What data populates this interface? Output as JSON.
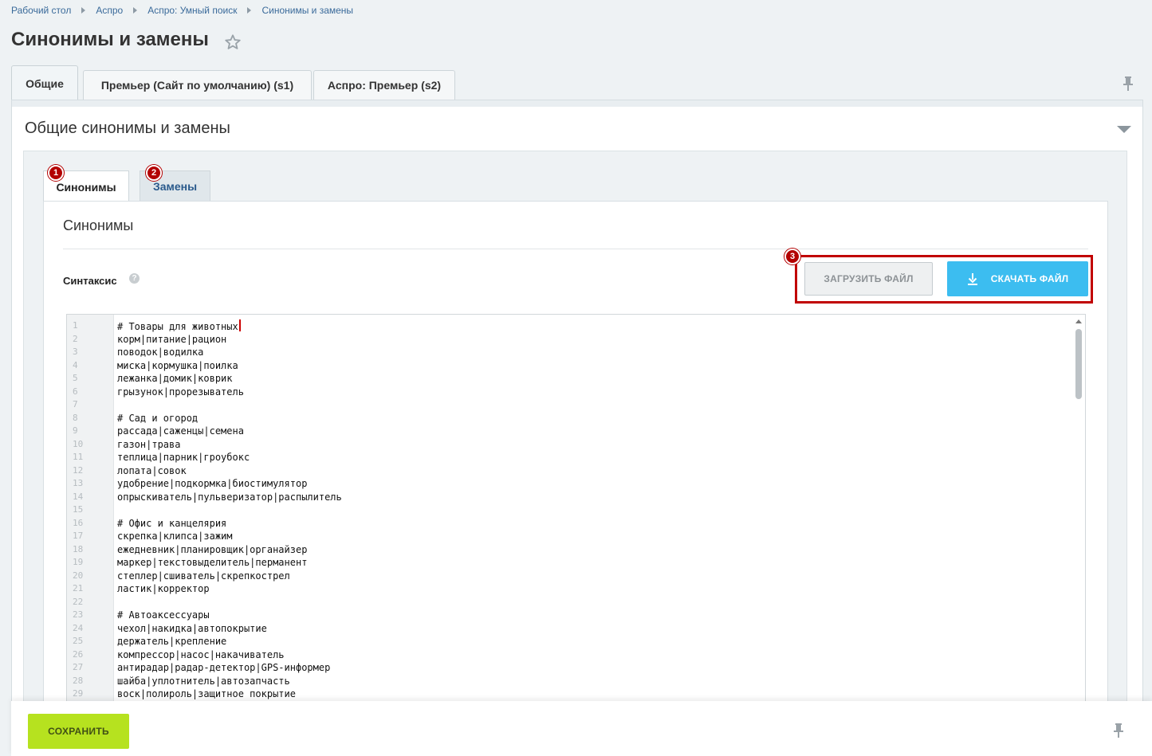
{
  "breadcrumbs": [
    "Рабочий стол",
    "Аспро",
    "Аспро: Умный поиск",
    "Синонимы и замены"
  ],
  "page_title": "Синонимы и замены",
  "top_tabs": [
    {
      "label": "Общие",
      "active": true
    },
    {
      "label": "Премьер (Сайт по умолчанию) (s1)",
      "active": false
    },
    {
      "label": "Аспро: Премьер (s2)",
      "active": false
    }
  ],
  "section_title": "Общие синонимы и замены",
  "sub_tabs": [
    {
      "label": "Синонимы",
      "badge": "1",
      "active": true
    },
    {
      "label": "Замены",
      "badge": "2",
      "active": false
    }
  ],
  "card_title": "Синонимы",
  "syntax_label": "Синтаксис",
  "help_symbol": "?",
  "buttons_badge": "3",
  "upload_button": "ЗАГРУЗИТЬ ФАЙЛ",
  "download_button": "СКАЧАТЬ ФАЙЛ",
  "save_button": "СОХРАНИТЬ",
  "colors": {
    "download": "#3cbdf0",
    "save": "#b6e21f",
    "highlight": "#c10000",
    "badge": "#b30000"
  },
  "code_lines": [
    {
      "n": "1",
      "text": "# Товары для животных"
    },
    {
      "n": "2",
      "text": "корм|питание|рацион"
    },
    {
      "n": "3",
      "text": "поводок|водилка"
    },
    {
      "n": "4",
      "text": "миска|кормушка|поилка"
    },
    {
      "n": "5",
      "text": "лежанка|домик|коврик"
    },
    {
      "n": "6",
      "text": "грызунок|прорезыватель"
    },
    {
      "n": "7",
      "text": ""
    },
    {
      "n": "8",
      "text": "# Сад и огород"
    },
    {
      "n": "9",
      "text": "рассада|саженцы|семена"
    },
    {
      "n": "10",
      "text": "газон|трава"
    },
    {
      "n": "11",
      "text": "теплица|парник|гроубокс"
    },
    {
      "n": "12",
      "text": "лопата|совок"
    },
    {
      "n": "13",
      "text": "удобрение|подкормка|биостимулятор"
    },
    {
      "n": "14",
      "text": "опрыскиватель|пульверизатор|распылитель"
    },
    {
      "n": "15",
      "text": ""
    },
    {
      "n": "16",
      "text": "# Офис и канцелярия"
    },
    {
      "n": "17",
      "text": "скрепка|клипса|зажим"
    },
    {
      "n": "18",
      "text": "ежедневник|планировщик|органайзер"
    },
    {
      "n": "19",
      "text": "маркер|текстовыделитель|перманент"
    },
    {
      "n": "20",
      "text": "степлер|сшиватель|скрепкострел"
    },
    {
      "n": "21",
      "text": "ластик|корректор"
    },
    {
      "n": "22",
      "text": ""
    },
    {
      "n": "23",
      "text": "# Автоаксессуары"
    },
    {
      "n": "24",
      "text": "чехол|накидка|автопокрытие"
    },
    {
      "n": "25",
      "text": "держатель|крепление"
    },
    {
      "n": "26",
      "text": "компрессор|насос|накачиватель"
    },
    {
      "n": "27",
      "text": "антирадар|радар-детектор|GPS-информер"
    },
    {
      "n": "28",
      "text": "шайба|уплотнитель|автозапчасть"
    },
    {
      "n": "29",
      "text": "воск|полироль|защитное покрытие"
    }
  ]
}
